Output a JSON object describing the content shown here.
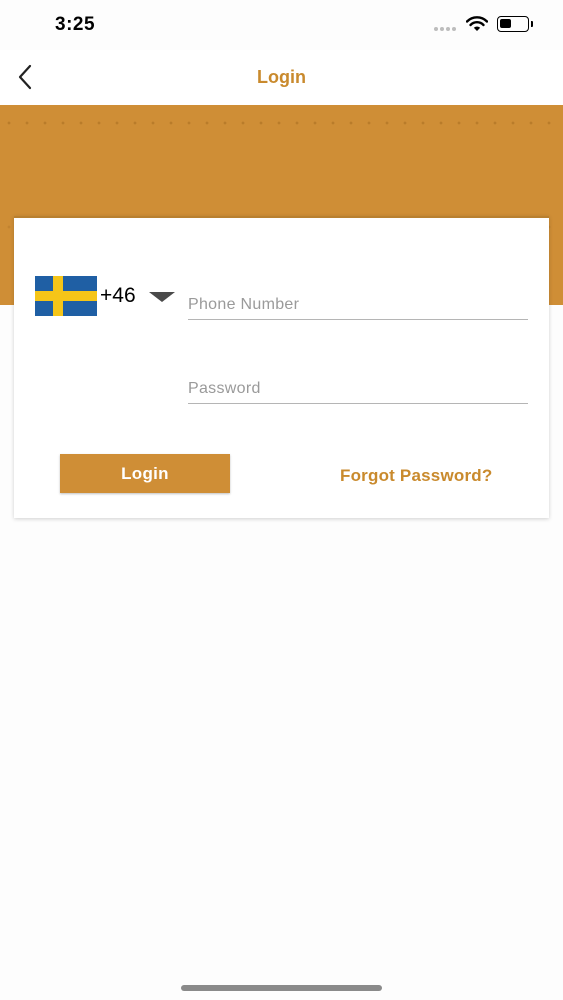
{
  "status_bar": {
    "time": "3:25",
    "battery_level": 0.45
  },
  "nav": {
    "title": "Login",
    "back_icon": "chevron-left-icon"
  },
  "country": {
    "flag": "sweden-flag-icon",
    "dial_code": "+46"
  },
  "form": {
    "phone_placeholder": "Phone Number",
    "phone_value": "",
    "password_placeholder": "Password",
    "password_value": "",
    "login_label": "Login",
    "forgot_label": "Forgot Password?"
  },
  "colors": {
    "accent": "#cf8e36",
    "accent_text": "#c98a2d",
    "flag_blue": "#1f5fa4",
    "flag_yellow": "#f5c518"
  }
}
